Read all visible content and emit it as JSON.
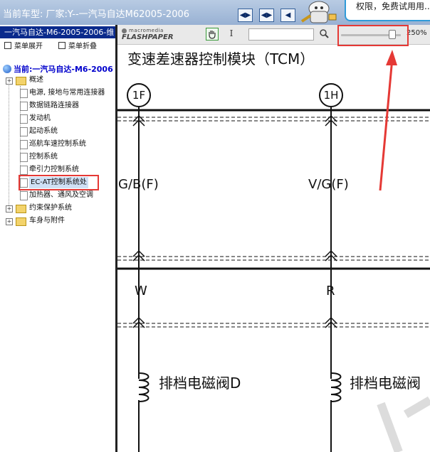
{
  "topbar": {
    "title": "当前车型:  厂家:Y--一汽马自达M62005-2006",
    "nav_buttons": [
      "nav-icon-a",
      "nav-icon-b",
      "nav-icon-c"
    ],
    "promo_text": "权限，免费试用用..."
  },
  "left_panel": {
    "header": "一汽马自达-M6-2005-2006-维",
    "expand_menu": "菜单展开",
    "collapse_menu": "菜单折叠",
    "current": "当前:一汽马自达-M6-2006",
    "tree": [
      {
        "label": "概述",
        "kind": "folder"
      },
      {
        "label": "电源, 接地与常用连接器",
        "kind": "doc"
      },
      {
        "label": "数据链路连接器",
        "kind": "doc"
      },
      {
        "label": "发动机",
        "kind": "doc"
      },
      {
        "label": "起动系统",
        "kind": "doc"
      },
      {
        "label": "巡航车速控制系统",
        "kind": "doc"
      },
      {
        "label": "控制系统",
        "kind": "doc"
      },
      {
        "label": "牵引力控制系统",
        "kind": "doc"
      },
      {
        "label": "EC-AT控制系统处",
        "kind": "doc",
        "selected": true
      },
      {
        "label": "加热器、通风及空调",
        "kind": "doc"
      },
      {
        "label": "约束保护系统",
        "kind": "folder"
      },
      {
        "label": "车身与附件",
        "kind": "folder"
      }
    ]
  },
  "toolbar": {
    "brand_top": "macromedia",
    "brand_bottom": "FLASHPAPER",
    "hand_tool": "hand-icon",
    "text_tool": "text-cursor-icon",
    "search_tool": "magnifier-icon",
    "zoom_level": 0.9,
    "zoom_text": "250%"
  },
  "document": {
    "title": "变速差速器控制模块（TCM）",
    "connectors": [
      "1F",
      "1H"
    ],
    "wire_colors_top": [
      "G/B(F)",
      "V/G(F)"
    ],
    "wire_colors_bottom": [
      "W",
      "R"
    ],
    "solenoid_labels": [
      "排档电磁阀D",
      "排档电磁阀"
    ]
  },
  "colors": {
    "highlight": "#e53935",
    "tree_header": "#0a2a8c",
    "selected_item": "#cfe0f5"
  }
}
